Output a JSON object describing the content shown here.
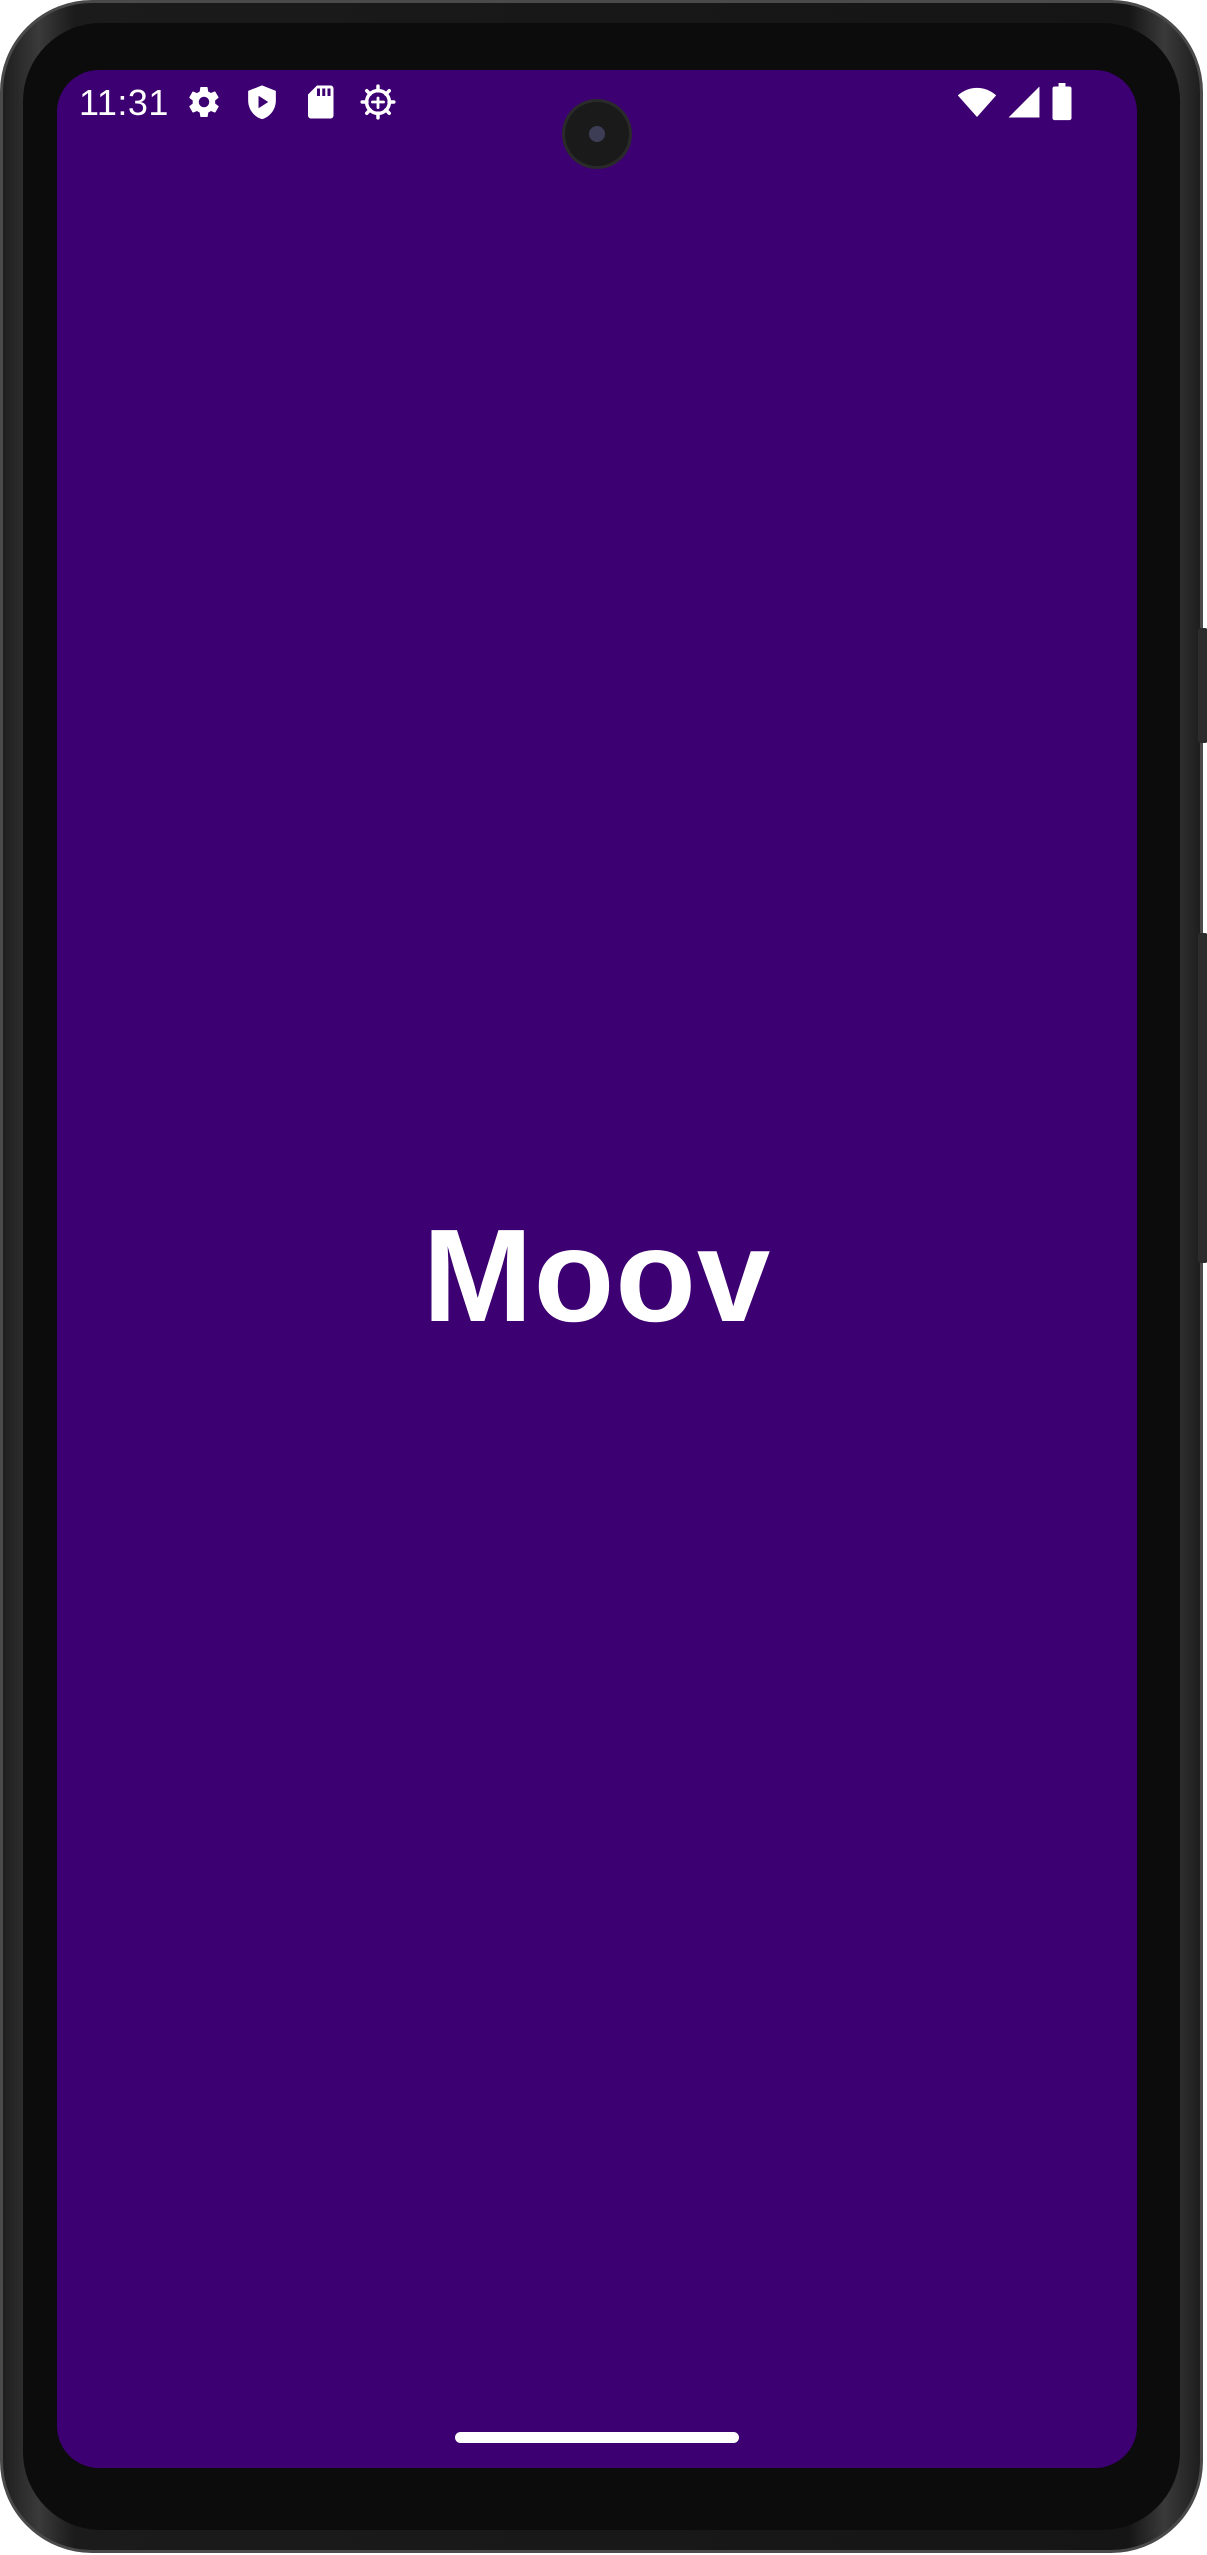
{
  "colors": {
    "background": "#3D0072",
    "text": "#FFFFFF"
  },
  "status_bar": {
    "time": "11:31",
    "left_icons": [
      "settings-icon",
      "play-protect-icon",
      "sd-card-icon",
      "debug-icon"
    ],
    "right_icons": [
      "wifi-icon",
      "cell-signal-icon",
      "battery-icon"
    ]
  },
  "splash": {
    "logo_text": "Moov"
  }
}
